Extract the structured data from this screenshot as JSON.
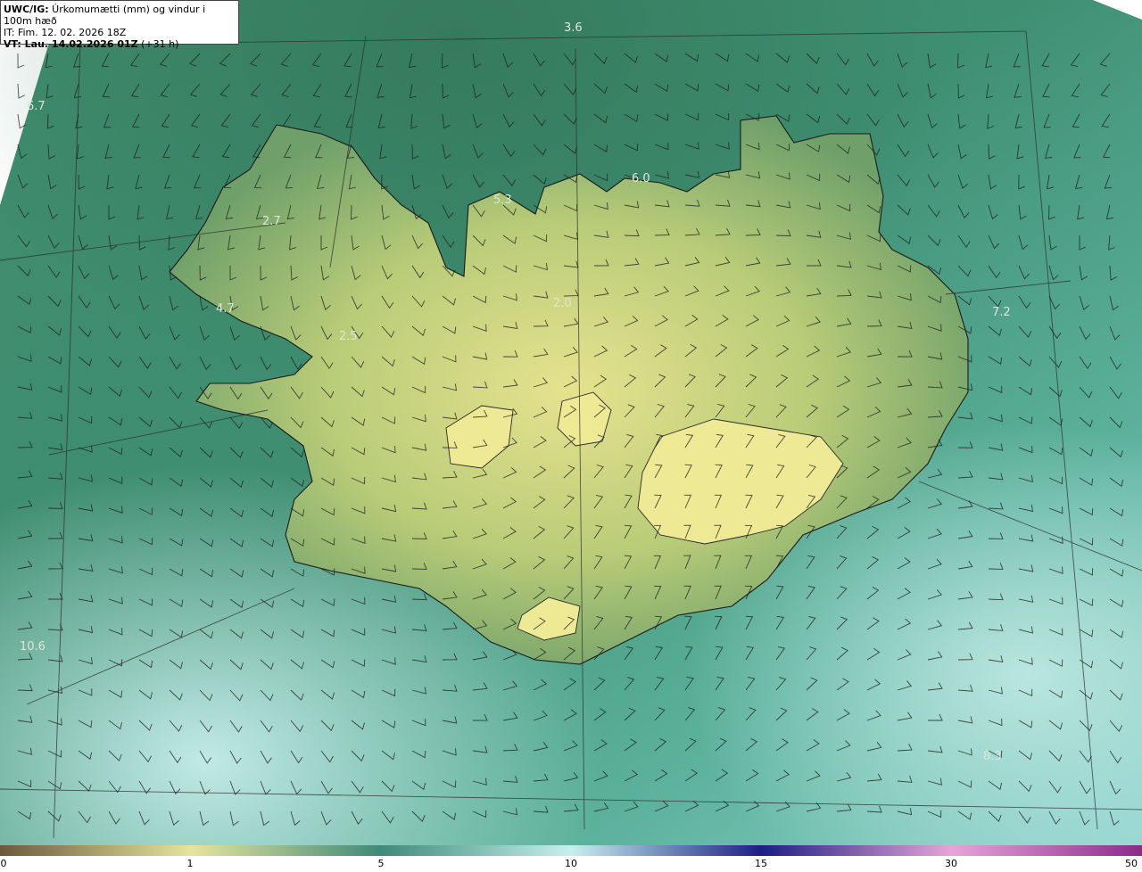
{
  "header": {
    "title_prefix": "UWC/IG:",
    "title_rest": " Úrkomumætti (mm) og vindur i 100m hæð",
    "issue_time": "IT: Fim. 12. 02. 2026 18Z",
    "valid_prefix": "VT: Lau. 14.02.2026 01Z",
    "valid_suffix": " (+31 h)"
  },
  "map_labels": [
    {
      "id": "lbl-1",
      "text": "3.6"
    },
    {
      "id": "lbl-2",
      "text": "6.7"
    },
    {
      "id": "lbl-3",
      "text": "5.3"
    },
    {
      "id": "lbl-4",
      "text": "6.0"
    },
    {
      "id": "lbl-5",
      "text": "2.7"
    },
    {
      "id": "lbl-6",
      "text": "4.7"
    },
    {
      "id": "lbl-7",
      "text": "2.5"
    },
    {
      "id": "lbl-8",
      "text": "2.0"
    },
    {
      "id": "lbl-9",
      "text": "7.2"
    },
    {
      "id": "lbl-10",
      "text": "10.6"
    },
    {
      "id": "lbl-11",
      "text": "8.3"
    }
  ],
  "colorbar": {
    "ticks": [
      "0",
      "1",
      "5",
      "10",
      "15",
      "30",
      "50"
    ],
    "colors": [
      "#6b5a3a",
      "#e8e49a",
      "#3e8a78",
      "#c6f0ef",
      "#1d1d86",
      "#e8a4d8",
      "#8c2a8c"
    ]
  }
}
